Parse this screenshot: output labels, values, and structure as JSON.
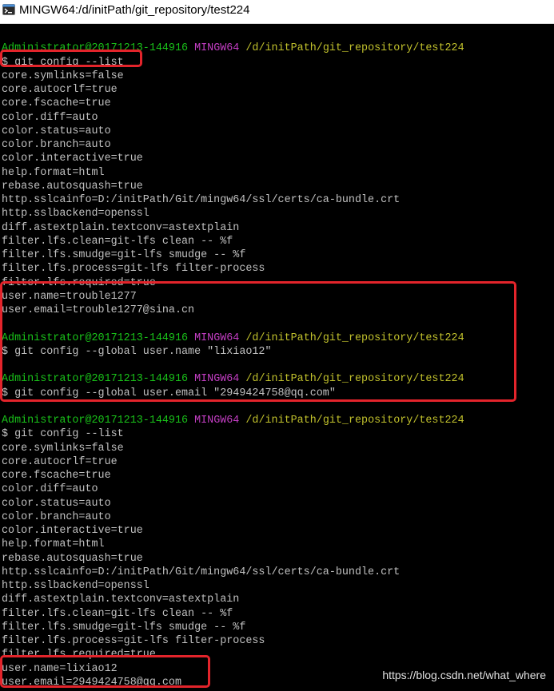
{
  "window": {
    "title": "MINGW64:/d/initPath/git_repository/test224",
    "icon": "mingw-terminal-icon"
  },
  "colors": {
    "background": "#000000",
    "prompt_user": "#19c219",
    "prompt_system": "#c33ec3",
    "prompt_path": "#c1c12c",
    "output": "#c0c0c0",
    "highlight_box": "#e3242b"
  },
  "terminal": {
    "lines": [
      {
        "kind": "blank",
        "text": ""
      },
      {
        "kind": "prompt",
        "user": "Administrator@20171213-144916",
        "system": "MINGW64",
        "path": "/d/initPath/git_repository/test224"
      },
      {
        "kind": "command",
        "text": "$ git config --list"
      },
      {
        "kind": "output",
        "text": "core.symlinks=false"
      },
      {
        "kind": "output",
        "text": "core.autocrlf=true"
      },
      {
        "kind": "output",
        "text": "core.fscache=true"
      },
      {
        "kind": "output",
        "text": "color.diff=auto"
      },
      {
        "kind": "output",
        "text": "color.status=auto"
      },
      {
        "kind": "output",
        "text": "color.branch=auto"
      },
      {
        "kind": "output",
        "text": "color.interactive=true"
      },
      {
        "kind": "output",
        "text": "help.format=html"
      },
      {
        "kind": "output",
        "text": "rebase.autosquash=true"
      },
      {
        "kind": "output",
        "text": "http.sslcainfo=D:/initPath/Git/mingw64/ssl/certs/ca-bundle.crt"
      },
      {
        "kind": "output",
        "text": "http.sslbackend=openssl"
      },
      {
        "kind": "output",
        "text": "diff.astextplain.textconv=astextplain"
      },
      {
        "kind": "output",
        "text": "filter.lfs.clean=git-lfs clean -- %f"
      },
      {
        "kind": "output",
        "text": "filter.lfs.smudge=git-lfs smudge -- %f"
      },
      {
        "kind": "output",
        "text": "filter.lfs.process=git-lfs filter-process"
      },
      {
        "kind": "output",
        "text": "filter.lfs.required=true"
      },
      {
        "kind": "output",
        "text": "user.name=trouble1277"
      },
      {
        "kind": "output",
        "text": "user.email=trouble1277@sina.cn"
      },
      {
        "kind": "blank",
        "text": ""
      },
      {
        "kind": "prompt",
        "user": "Administrator@20171213-144916",
        "system": "MINGW64",
        "path": "/d/initPath/git_repository/test224"
      },
      {
        "kind": "command",
        "text": "$ git config --global user.name \"lixiao12\""
      },
      {
        "kind": "blank",
        "text": ""
      },
      {
        "kind": "prompt",
        "user": "Administrator@20171213-144916",
        "system": "MINGW64",
        "path": "/d/initPath/git_repository/test224"
      },
      {
        "kind": "command",
        "text": "$ git config --global user.email \"2949424758@qq.com\""
      },
      {
        "kind": "blank",
        "text": ""
      },
      {
        "kind": "prompt",
        "user": "Administrator@20171213-144916",
        "system": "MINGW64",
        "path": "/d/initPath/git_repository/test224"
      },
      {
        "kind": "command",
        "text": "$ git config --list"
      },
      {
        "kind": "output",
        "text": "core.symlinks=false"
      },
      {
        "kind": "output",
        "text": "core.autocrlf=true"
      },
      {
        "kind": "output",
        "text": "core.fscache=true"
      },
      {
        "kind": "output",
        "text": "color.diff=auto"
      },
      {
        "kind": "output",
        "text": "color.status=auto"
      },
      {
        "kind": "output",
        "text": "color.branch=auto"
      },
      {
        "kind": "output",
        "text": "color.interactive=true"
      },
      {
        "kind": "output",
        "text": "help.format=html"
      },
      {
        "kind": "output",
        "text": "rebase.autosquash=true"
      },
      {
        "kind": "output",
        "text": "http.sslcainfo=D:/initPath/Git/mingw64/ssl/certs/ca-bundle.crt"
      },
      {
        "kind": "output",
        "text": "http.sslbackend=openssl"
      },
      {
        "kind": "output",
        "text": "diff.astextplain.textconv=astextplain"
      },
      {
        "kind": "output",
        "text": "filter.lfs.clean=git-lfs clean -- %f"
      },
      {
        "kind": "output",
        "text": "filter.lfs.smudge=git-lfs smudge -- %f"
      },
      {
        "kind": "output",
        "text": "filter.lfs.process=git-lfs filter-process"
      },
      {
        "kind": "output",
        "text": "filter.lfs.required=true"
      },
      {
        "kind": "output",
        "text": "user.name=lixiao12"
      },
      {
        "kind": "output",
        "text": "user.email=2949424758@qq.com"
      }
    ]
  },
  "watermark": {
    "text": "https://blog.csdn.net/what_where"
  }
}
